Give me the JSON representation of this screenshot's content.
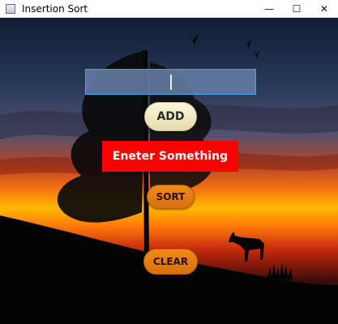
{
  "window": {
    "title": "Insertion Sort",
    "controls": {
      "minimize_icon": "minimize-icon",
      "maximize_icon": "maximize-icon",
      "close_icon": "close-icon"
    }
  },
  "form": {
    "input_value": "",
    "add_label": "ADD",
    "message": "Eneter Something",
    "sort_label": "SORT",
    "clear_label": "CLEAR"
  },
  "colors": {
    "message_bg": "#ff0000",
    "add_button": "#f2ebc2",
    "sort_clear_button": "#e87d12",
    "input_bg": "#6a83a8",
    "input_border": "#3aa7e8"
  }
}
